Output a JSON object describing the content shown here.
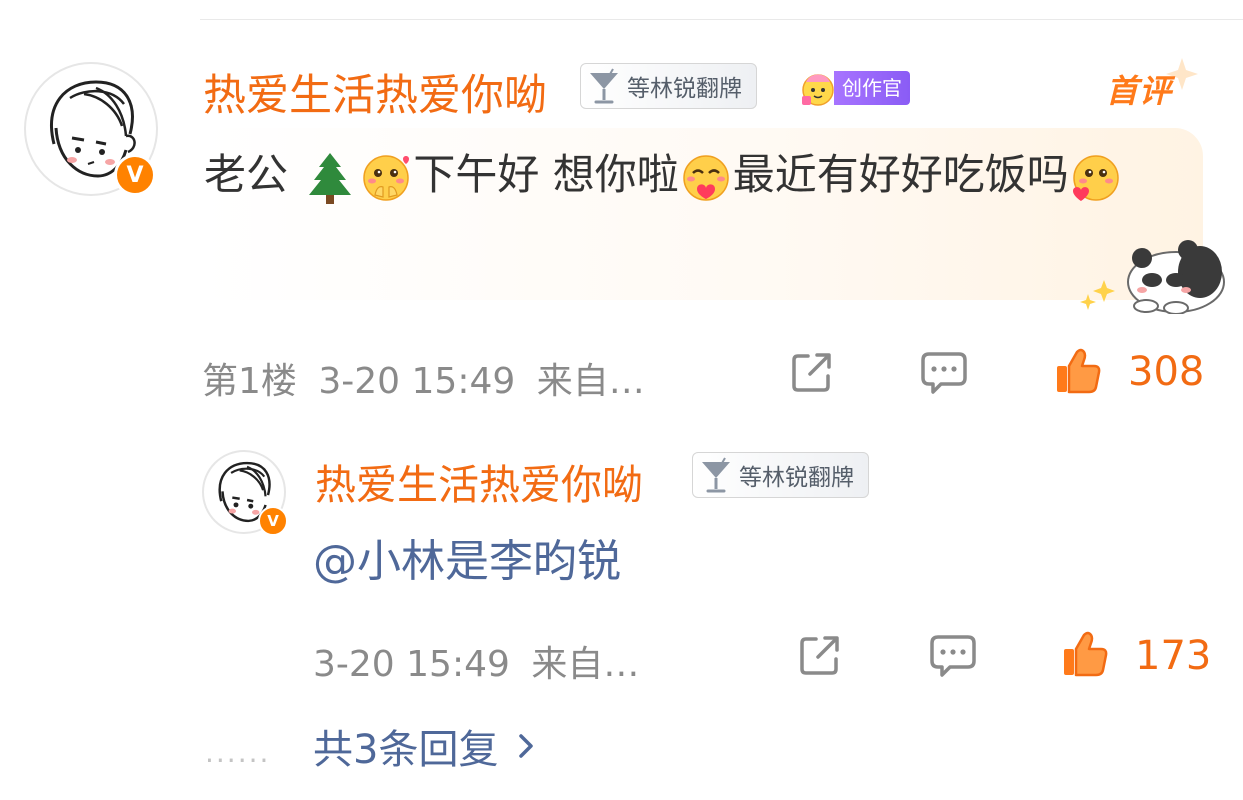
{
  "comment": {
    "username": "热爱生活热爱你呦",
    "fan_badge": "等林锐翻牌",
    "creator_badge": "创作官",
    "first_tag": "首评",
    "text_part1": "老公 ",
    "text_part2": "下午好 想你啦",
    "text_part3": "最近有好好吃饭吗",
    "floor": "第1楼",
    "time": "3-20 15:49",
    "source": "来自…",
    "likes": "308"
  },
  "reply": {
    "username": "热爱生活热爱你呦",
    "fan_badge": "等林锐翻牌",
    "text": "@小林是李昀锐",
    "time": "3-20 15:49",
    "source": "来自…",
    "likes": "173"
  },
  "more_replies": {
    "dots": "······",
    "label": "共3条回复"
  },
  "colors": {
    "username": "#f26b13",
    "like_accent": "#f26b13",
    "link_blue": "#4f6899",
    "verified_badge": "#ff8200",
    "creator_purple": "#9b6bfa"
  },
  "icons": [
    "verified-v-icon",
    "cocktail-cup-icon",
    "pine-tree-emoji",
    "blush-emoji",
    "hugging-emoji",
    "love-emoji",
    "share-icon",
    "comment-icon",
    "thumbs-up-icon",
    "chevron-right-icon"
  ]
}
